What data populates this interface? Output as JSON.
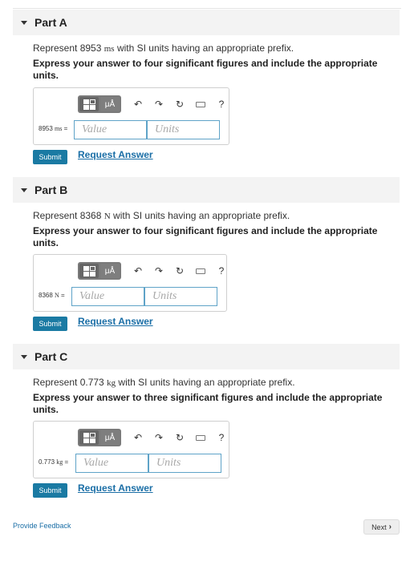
{
  "parts": [
    {
      "title": "Part A",
      "prompt_prefix": "Represent 8953",
      "prompt_unit": "ms",
      "prompt_suffix": "with SI units having an appropriate prefix.",
      "instruction": "Express your answer to four significant figures and include the appropriate units.",
      "eq_number": "8953",
      "eq_unit": "ms",
      "eq_sign": "=",
      "value_placeholder": "Value",
      "units_placeholder": "Units",
      "submit": "Submit",
      "request": "Request Answer"
    },
    {
      "title": "Part B",
      "prompt_prefix": "Represent 8368",
      "prompt_unit": "N",
      "prompt_suffix": "with SI units having an appropriate prefix.",
      "instruction": "Express your answer to four significant figures and include the appropriate units.",
      "eq_number": "8368",
      "eq_unit": "N",
      "eq_sign": "=",
      "value_placeholder": "Value",
      "units_placeholder": "Units",
      "submit": "Submit",
      "request": "Request Answer"
    },
    {
      "title": "Part C",
      "prompt_prefix": "Represent 0.773",
      "prompt_unit": "kg",
      "prompt_suffix": "with SI units having an appropriate prefix.",
      "instruction": "Express your answer to three significant figures and include the appropriate units.",
      "eq_number": "0.773",
      "eq_unit": "kg",
      "eq_sign": "=",
      "value_placeholder": "Value",
      "units_placeholder": "Units",
      "submit": "Submit",
      "request": "Request Answer"
    }
  ],
  "toolbar": {
    "units_button": "μÅ",
    "undo_icon": "↶",
    "redo_icon": "↷",
    "reset_icon": "↻",
    "help": "?"
  },
  "footer": {
    "feedback": "Provide Feedback",
    "next": "Next",
    "next_icon": "›"
  }
}
